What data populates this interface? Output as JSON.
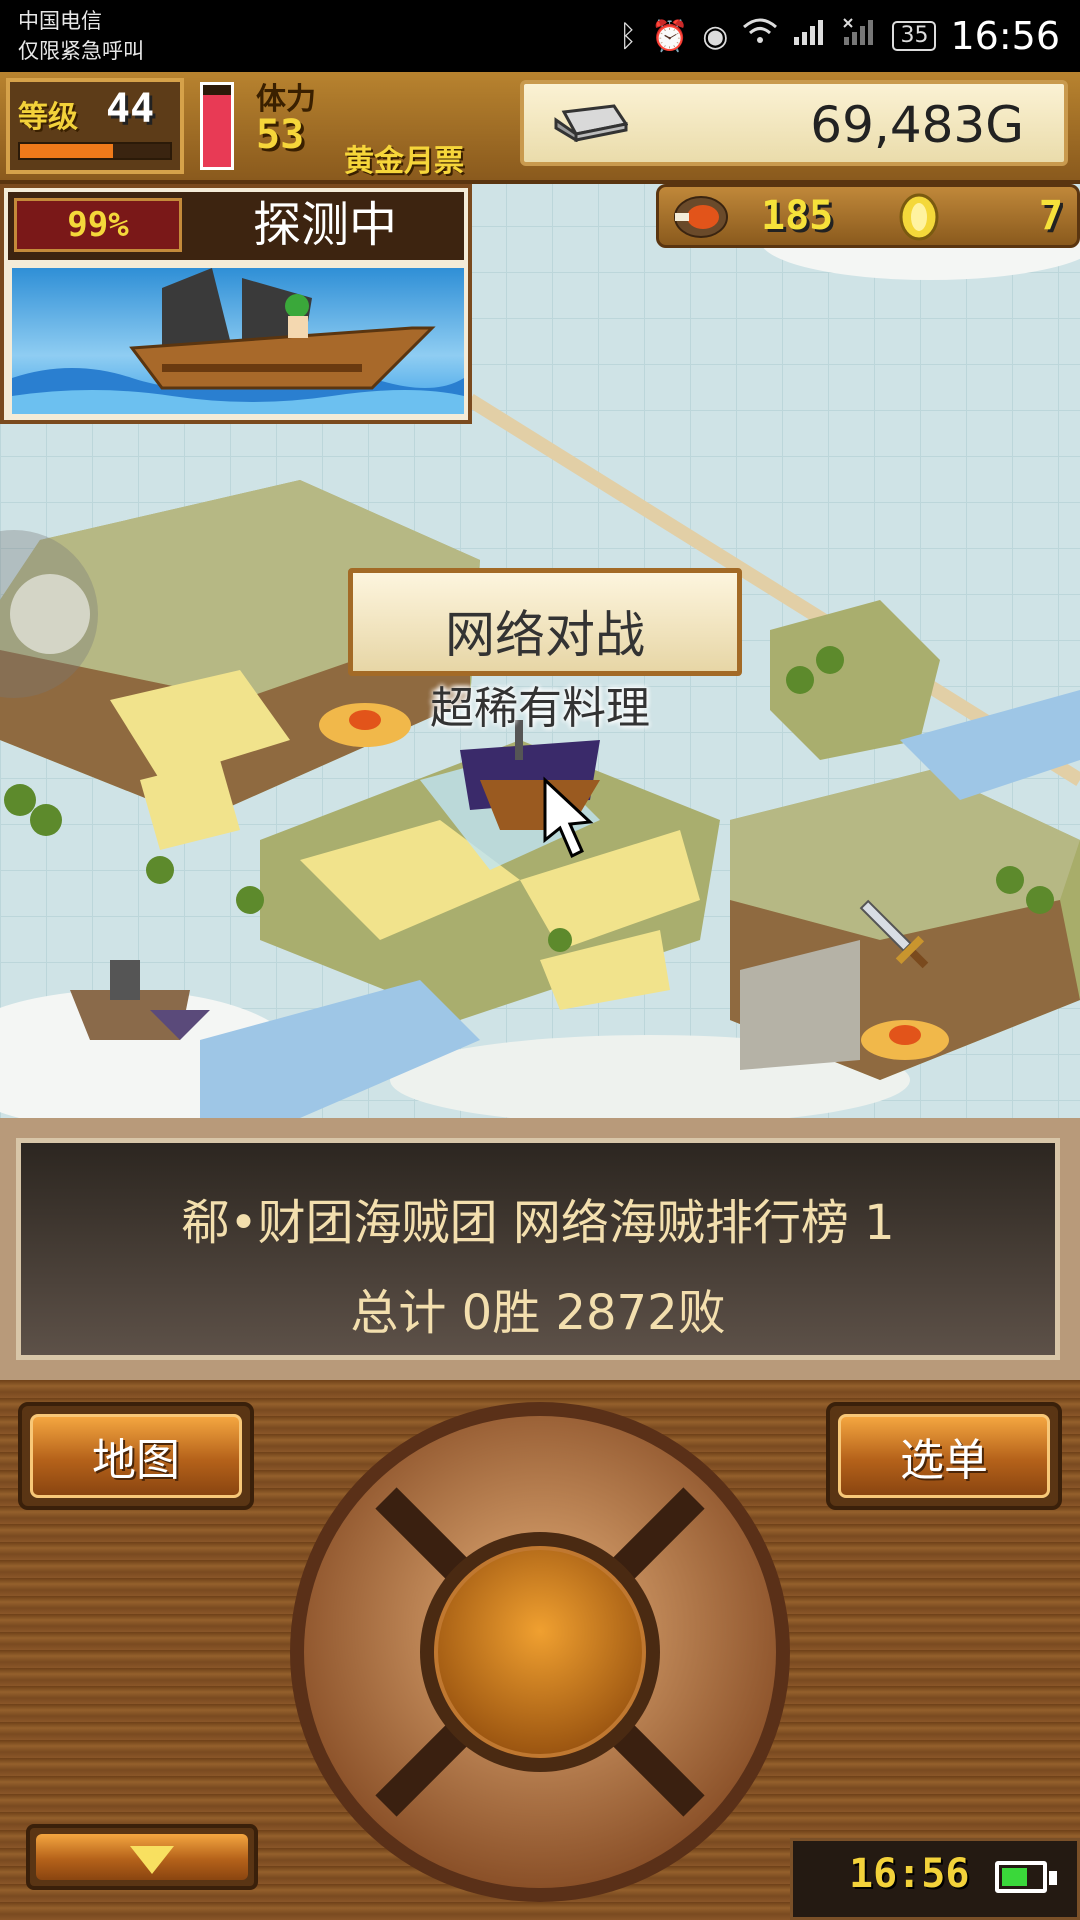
{
  "status_bar": {
    "carrier_line1": "中国电信",
    "carrier_line2": "仅限紧急呼叫",
    "battery": "35",
    "time": "16:56",
    "icons": [
      "bluetooth-icon",
      "alarm-icon",
      "eye-icon",
      "wifi-icon",
      "signal-icon",
      "no-signal-icon"
    ]
  },
  "hud": {
    "level_label": "等级",
    "level": "44",
    "level_progress": 0.62,
    "stamina_label": "体力",
    "stamina": "53",
    "stamina_gauge": 0.88,
    "golden_ticket": "黄金月票",
    "gold": "69,483G",
    "meat": "185",
    "medals": "7"
  },
  "exploration": {
    "percent": "99%",
    "status": "探测中"
  },
  "map": {
    "popup_label": "网络对战",
    "ship_name": "超稀有料理"
  },
  "info": {
    "line1": "郗•财团海贼团  网络海贼排行榜  1",
    "line2": "总计 0胜 2872败"
  },
  "controls": {
    "map_button": "地图",
    "menu_button": "选单",
    "clock": "16:56",
    "battery_level": 0.7
  },
  "colors": {
    "accent_gold": "#f6d63a",
    "wood": "#8a5a1d",
    "info_text": "#f3dfae"
  }
}
